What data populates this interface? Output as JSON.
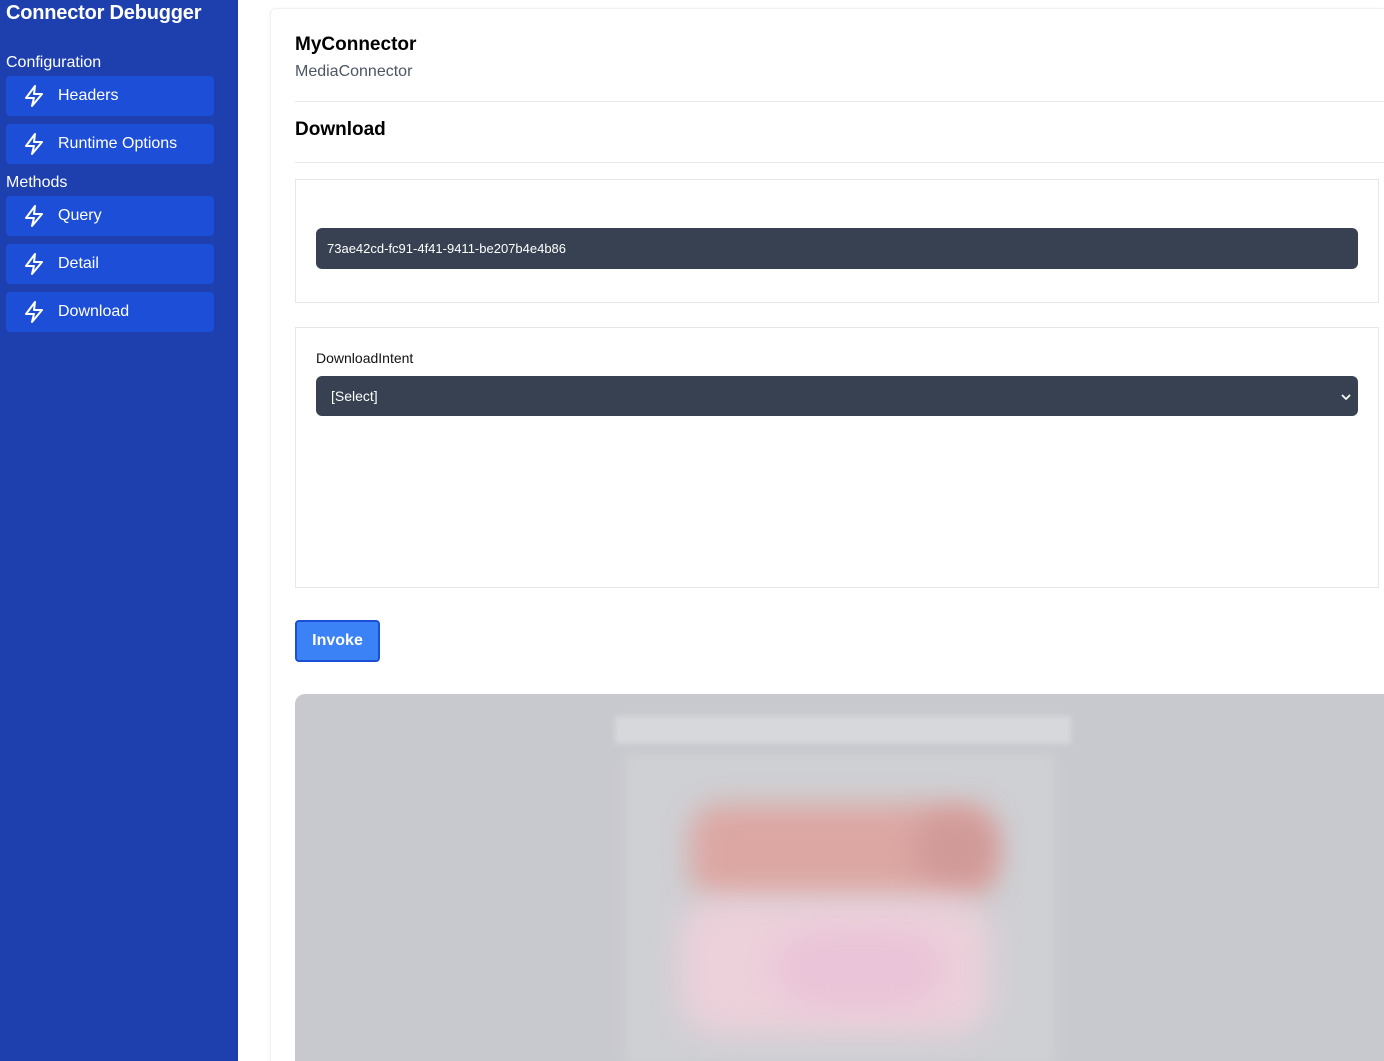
{
  "sidebar": {
    "title": "Connector Debugger",
    "sections": [
      {
        "label": "Configuration",
        "items": [
          {
            "label": "Headers",
            "icon": "bolt-icon"
          },
          {
            "label": "Runtime Options",
            "icon": "bolt-icon"
          }
        ]
      },
      {
        "label": "Methods",
        "items": [
          {
            "label": "Query",
            "icon": "bolt-icon"
          },
          {
            "label": "Detail",
            "icon": "bolt-icon"
          },
          {
            "label": "Download",
            "icon": "bolt-icon"
          }
        ]
      }
    ]
  },
  "main": {
    "connector_name": "MyConnector",
    "connector_type": "MediaConnector",
    "method_title": "Download",
    "id_field": {
      "value": "73ae42cd-fc91-4f41-9411-be207b4e4b86"
    },
    "intent_field": {
      "label": "DownloadIntent",
      "selected": "[Select]",
      "icon": "chevron-down-icon"
    },
    "invoke_label": "Invoke"
  },
  "colors": {
    "sidebar_bg": "#1e40af",
    "nav_item_bg": "#1d4ed8",
    "field_bg": "#374151",
    "invoke_bg": "#3b82f6",
    "preview_bg": "#c8c9ce"
  }
}
